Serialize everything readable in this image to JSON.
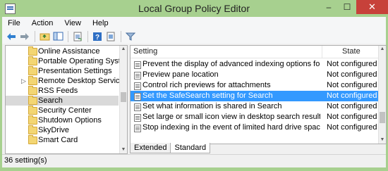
{
  "window": {
    "title": "Local Group Policy Editor",
    "minimize_glyph": "‒",
    "maximize_glyph": "☐",
    "close_glyph": "✕"
  },
  "menu": [
    "File",
    "Action",
    "View",
    "Help"
  ],
  "toolbar": {
    "buttons": [
      "back-arrow-icon",
      "forward-arrow-icon",
      "up-folder-icon",
      "show-hide-tree-icon",
      "export-list-icon",
      "help-icon",
      "properties-icon",
      "filter-icon"
    ]
  },
  "tree": {
    "items": [
      {
        "label": "Online Assistance",
        "expandable": false,
        "selected": false
      },
      {
        "label": "Portable Operating System",
        "expandable": false,
        "selected": false
      },
      {
        "label": "Presentation Settings",
        "expandable": false,
        "selected": false
      },
      {
        "label": "Remote Desktop Services",
        "expandable": true,
        "selected": false
      },
      {
        "label": "RSS Feeds",
        "expandable": false,
        "selected": false
      },
      {
        "label": "Search",
        "expandable": false,
        "selected": true
      },
      {
        "label": "Security Center",
        "expandable": false,
        "selected": false
      },
      {
        "label": "Shutdown Options",
        "expandable": false,
        "selected": false
      },
      {
        "label": "SkyDrive",
        "expandable": false,
        "selected": false
      },
      {
        "label": "Smart Card",
        "expandable": false,
        "selected": false
      }
    ]
  },
  "list": {
    "columns": {
      "setting": "Setting",
      "state": "State"
    },
    "rows": [
      {
        "name": "Prevent the display of advanced indexing options for Windo...",
        "state": "Not configured",
        "selected": false
      },
      {
        "name": "Preview pane location",
        "state": "Not configured",
        "selected": false
      },
      {
        "name": "Control rich previews for attachments",
        "state": "Not configured",
        "selected": false
      },
      {
        "name": "Set the SafeSearch setting for Search",
        "state": "Not configured",
        "selected": true
      },
      {
        "name": "Set what information is shared in Search",
        "state": "Not configured",
        "selected": false
      },
      {
        "name": "Set large or small icon view in desktop search results",
        "state": "Not configured",
        "selected": false
      },
      {
        "name": "Stop indexing in the event of limited hard drive space",
        "state": "Not configured",
        "selected": false
      }
    ]
  },
  "tabs": [
    {
      "label": "Extended",
      "active": false
    },
    {
      "label": "Standard",
      "active": true
    }
  ],
  "status": {
    "text": "36 setting(s)"
  },
  "colors": {
    "chrome": "#a7d08f",
    "selection": "#3399ff",
    "close": "#c7413a"
  }
}
